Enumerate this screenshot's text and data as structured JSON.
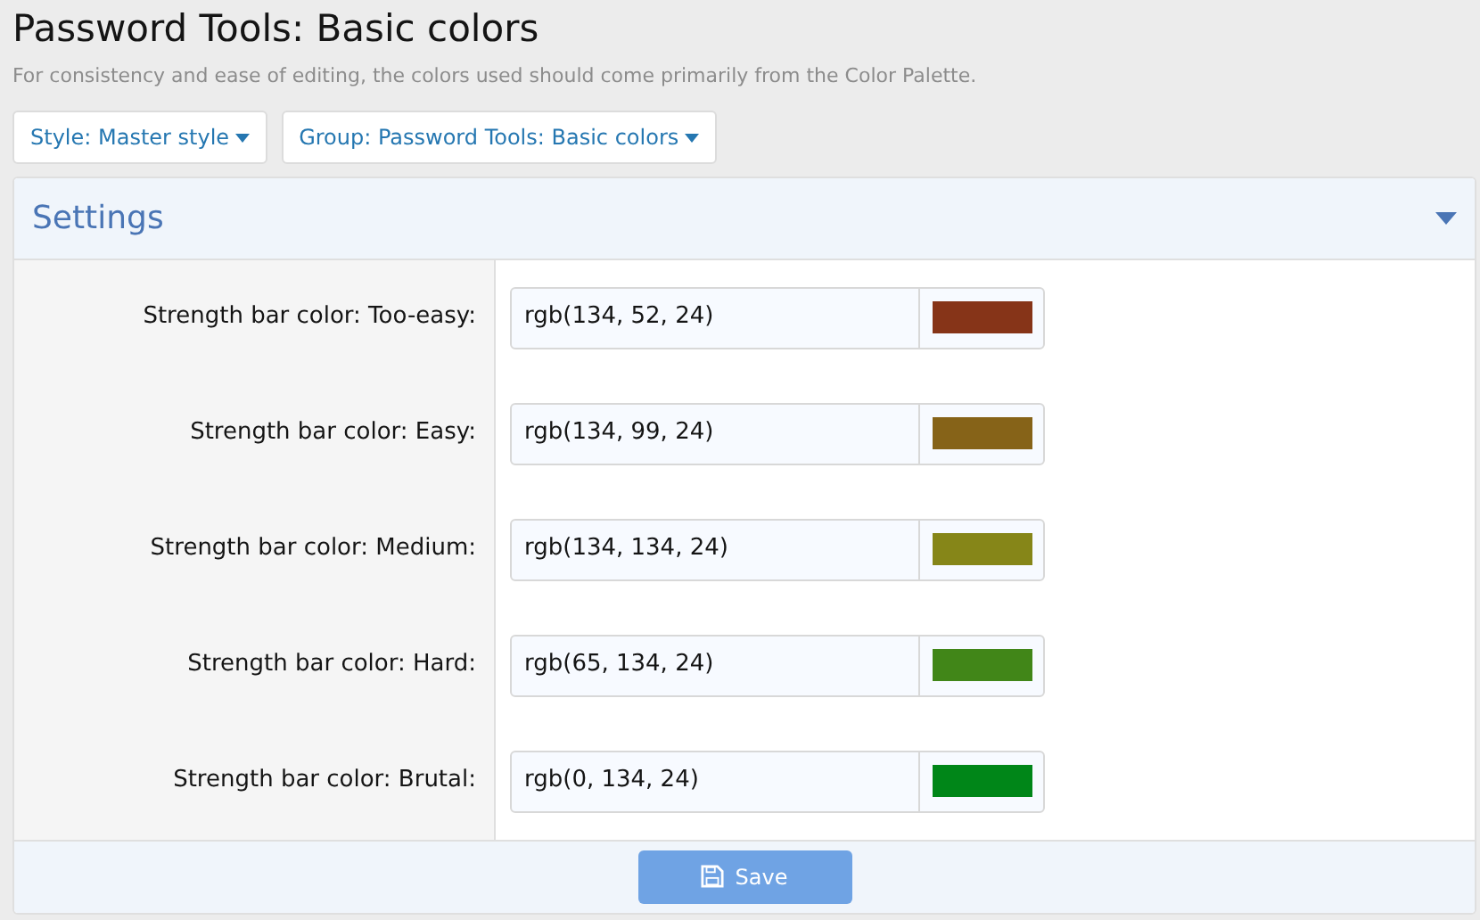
{
  "page": {
    "title": "Password Tools: Basic colors",
    "description": "For consistency and ease of editing, the colors used should come primarily from the Color Palette."
  },
  "filters": [
    {
      "label": "Style: Master style"
    },
    {
      "label": "Group: Password Tools: Basic colors"
    }
  ],
  "settings": {
    "title": "Settings",
    "expanded": true,
    "rows": [
      {
        "label": "Strength bar color: Too-easy:",
        "value": "rgb(134, 52, 24)",
        "color": "#863418"
      },
      {
        "label": "Strength bar color: Easy:",
        "value": "rgb(134, 99, 24)",
        "color": "#866318"
      },
      {
        "label": "Strength bar color: Medium:",
        "value": "rgb(134, 134, 24)",
        "color": "#868618"
      },
      {
        "label": "Strength bar color: Hard:",
        "value": "rgb(65, 134, 24)",
        "color": "#418618"
      },
      {
        "label": "Strength bar color: Brutal:",
        "value": "rgb(0, 134, 24)",
        "color": "#008618"
      }
    ]
  },
  "save_button": {
    "label": "Save",
    "disabled": true
  }
}
